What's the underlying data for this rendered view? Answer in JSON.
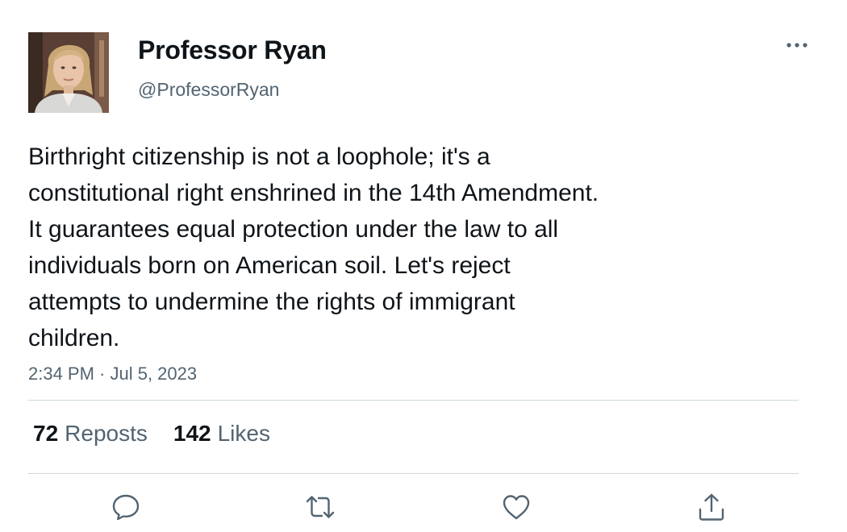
{
  "author": {
    "name": "Professor Ryan",
    "handle": "@ProfessorRyan",
    "avatar_icon": "profile-photo"
  },
  "tweet": {
    "lines": [
      "Birthright citizenship is not a loophole; it's a",
      "constitutional right enshrined in the 14th Amendment.",
      "It guarantees equal protection under the law to all",
      "individuals born on American soil. Let's reject",
      "attempts to undermine the rights of immigrant",
      "children."
    ],
    "timestamp": "2:34 PM · Jul 5, 2023"
  },
  "stats": {
    "reposts": {
      "count": "72",
      "label": "Reposts"
    },
    "likes": {
      "count": "142",
      "label": "Likes"
    }
  },
  "actions": {
    "reply_icon": "reply-icon",
    "repost_icon": "repost-icon",
    "like_icon": "heart-icon",
    "share_icon": "share-icon"
  },
  "colors": {
    "text_primary": "#0f1419",
    "text_secondary": "#536471",
    "divider": "#cfd9de"
  }
}
